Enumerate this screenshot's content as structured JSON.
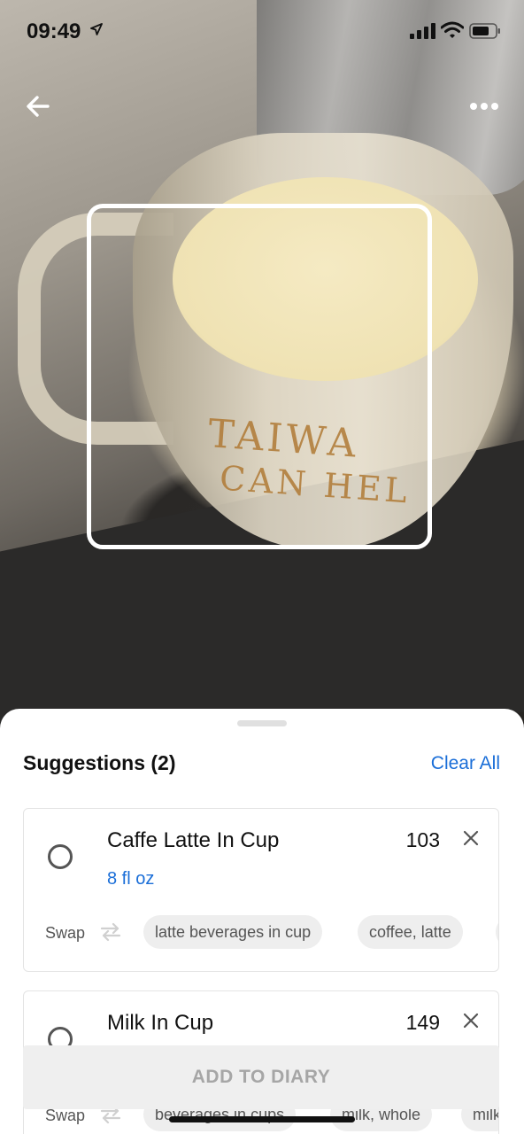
{
  "status_bar": {
    "time": "09:49",
    "icons": [
      "location-arrow-icon",
      "signal-icon",
      "wifi-icon",
      "battery-icon"
    ]
  },
  "photo": {
    "mug_text_line1": "TAIWA",
    "mug_text_line2": "CAN HEL"
  },
  "toolbar": {
    "back_icon": "arrow-left-icon",
    "more_icon": "more-horizontal-icon"
  },
  "sheet": {
    "title": "Suggestions (2)",
    "clear_all": "Clear All",
    "suggestions": [
      {
        "name": "Caffe Latte In Cup",
        "calories": "103",
        "serving": "8 fl oz",
        "swap_label": "Swap",
        "chips": [
          "latte beverages in cup",
          "coffee, latte"
        ]
      },
      {
        "name": "Milk In Cup",
        "calories": "149",
        "serving": "",
        "swap_label": "Swap",
        "chips": [
          "beverages in cups",
          "milk, whole",
          "milk"
        ]
      }
    ],
    "add_button": "ADD TO DIARY"
  },
  "colors": {
    "accent": "#1a6ed8",
    "sheet_bg": "#ffffff",
    "chip_bg": "#eeeeee",
    "disabled_text": "#a6a6a6"
  }
}
